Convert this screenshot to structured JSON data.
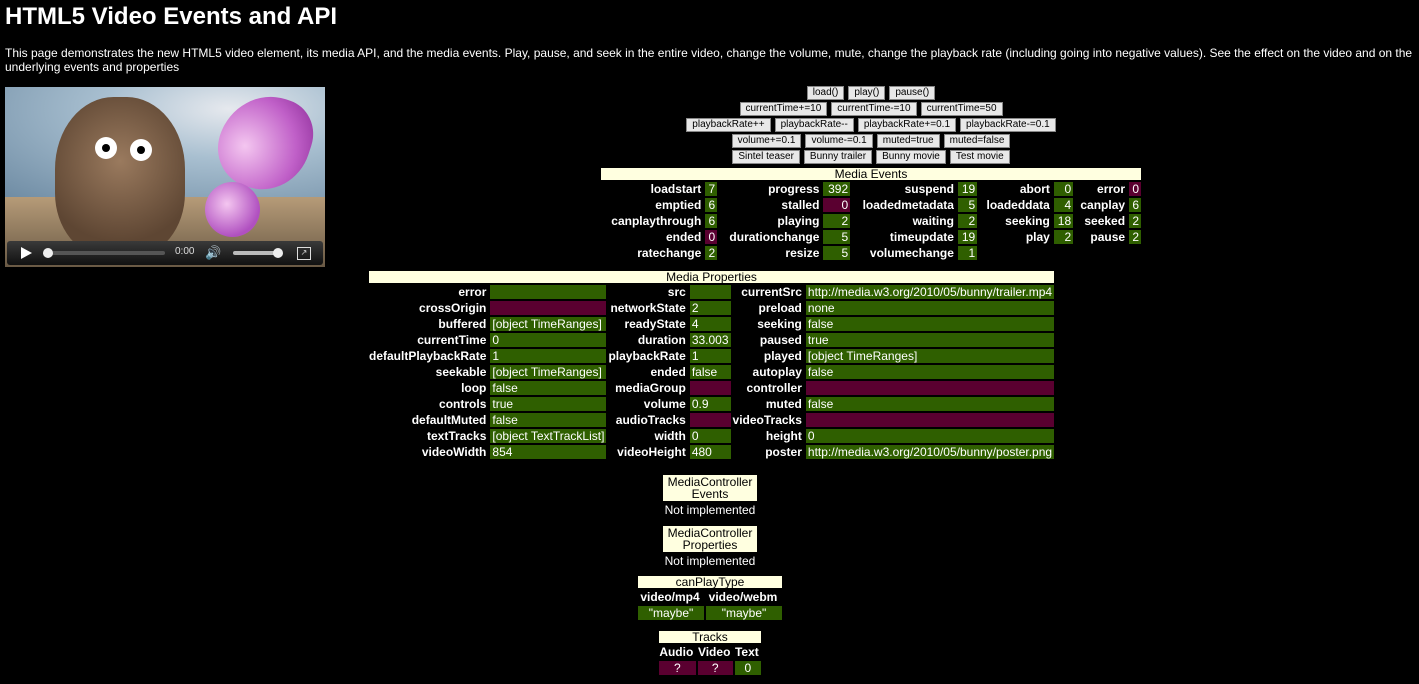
{
  "page": {
    "title": "HTML5 Video Events and API",
    "intro": "This page demonstrates the new HTML5 video element, its media API, and the media events. Play, pause, and seek in the entire video, change the volume, mute, change the playback rate (including going into negative values). See the effect on the video and on the underlying events and properties"
  },
  "video": {
    "time": "0:00"
  },
  "buttons": [
    [
      "load()",
      "play()",
      "pause()"
    ],
    [
      "currentTime+=10",
      "currentTime-=10",
      "currentTime=50"
    ],
    [
      "playbackRate++",
      "playbackRate--",
      "playbackRate+=0.1",
      "playbackRate-=0.1"
    ],
    [
      "volume+=0.1",
      "volume-=0.1",
      "muted=true",
      "muted=false"
    ],
    [
      "Sintel teaser",
      "Bunny trailer",
      "Bunny movie",
      "Test movie"
    ]
  ],
  "events": {
    "header": "Media Events",
    "rows": [
      [
        [
          "loadstart",
          "7",
          ""
        ],
        [
          "progress",
          "392",
          ""
        ],
        [
          "suspend",
          "19",
          ""
        ],
        [
          "abort",
          "0",
          ""
        ],
        [
          "error",
          "0",
          "bad"
        ]
      ],
      [
        [
          "emptied",
          "6",
          ""
        ],
        [
          "stalled",
          "0",
          "bad"
        ],
        [
          "loadedmetadata",
          "5",
          ""
        ],
        [
          "loadeddata",
          "4",
          ""
        ],
        [
          "canplay",
          "6",
          ""
        ]
      ],
      [
        [
          "canplaythrough",
          "6",
          ""
        ],
        [
          "playing",
          "2",
          ""
        ],
        [
          "waiting",
          "2",
          ""
        ],
        [
          "seeking",
          "18",
          ""
        ],
        [
          "seeked",
          "2",
          ""
        ]
      ],
      [
        [
          "ended",
          "0",
          "bad"
        ],
        [
          "durationchange",
          "5",
          ""
        ],
        [
          "timeupdate",
          "19",
          ""
        ],
        [
          "play",
          "2",
          ""
        ],
        [
          "pause",
          "2",
          ""
        ]
      ],
      [
        [
          "ratechange",
          "2",
          ""
        ],
        [
          "resize",
          "5",
          ""
        ],
        [
          "volumechange",
          "1",
          ""
        ]
      ]
    ]
  },
  "properties": {
    "header": "Media Properties",
    "rows": [
      [
        [
          "error",
          "",
          ""
        ],
        [
          "src",
          "",
          ""
        ],
        [
          "currentSrc",
          "http://media.w3.org/2010/05/bunny/trailer.mp4",
          ""
        ]
      ],
      [
        [
          "crossOrigin",
          "",
          "bad"
        ],
        [
          "networkState",
          "2",
          ""
        ],
        [
          "preload",
          "none",
          ""
        ]
      ],
      [
        [
          "buffered",
          "[object TimeRanges]",
          ""
        ],
        [
          "readyState",
          "4",
          ""
        ],
        [
          "seeking",
          "false",
          ""
        ]
      ],
      [
        [
          "currentTime",
          "0",
          ""
        ],
        [
          "duration",
          "33.003",
          ""
        ],
        [
          "paused",
          "true",
          ""
        ]
      ],
      [
        [
          "defaultPlaybackRate",
          "1",
          ""
        ],
        [
          "playbackRate",
          "1",
          ""
        ],
        [
          "played",
          "[object TimeRanges]",
          ""
        ]
      ],
      [
        [
          "seekable",
          "[object TimeRanges]",
          ""
        ],
        [
          "ended",
          "false",
          ""
        ],
        [
          "autoplay",
          "false",
          ""
        ]
      ],
      [
        [
          "loop",
          "false",
          ""
        ],
        [
          "mediaGroup",
          "",
          "bad"
        ],
        [
          "controller",
          "",
          "bad"
        ]
      ],
      [
        [
          "controls",
          "true",
          ""
        ],
        [
          "volume",
          "0.9",
          ""
        ],
        [
          "muted",
          "false",
          ""
        ]
      ],
      [
        [
          "defaultMuted",
          "false",
          ""
        ],
        [
          "audioTracks",
          "",
          "bad"
        ],
        [
          "videoTracks",
          "",
          "bad"
        ]
      ],
      [
        [
          "textTracks",
          "[object TextTrackList]",
          ""
        ],
        [
          "width",
          "0",
          ""
        ],
        [
          "height",
          "0",
          ""
        ]
      ],
      [
        [
          "videoWidth",
          "854",
          ""
        ],
        [
          "videoHeight",
          "480",
          ""
        ],
        [
          "poster",
          "http://media.w3.org/2010/05/bunny/poster.png",
          ""
        ]
      ]
    ]
  },
  "mc_events": {
    "header": "MediaController Events",
    "note": "Not implemented"
  },
  "mc_props": {
    "header": "MediaController Properties",
    "note": "Not implemented"
  },
  "canplaytype": {
    "header": "canPlayType",
    "labels": [
      "video/mp4",
      "video/webm"
    ],
    "values": [
      "\"maybe\"",
      "\"maybe\""
    ]
  },
  "tracks": {
    "header": "Tracks",
    "labels": [
      "Audio",
      "Video",
      "Text"
    ],
    "values": [
      [
        "?",
        "bad"
      ],
      [
        "?",
        "bad"
      ],
      [
        "0",
        ""
      ]
    ]
  }
}
